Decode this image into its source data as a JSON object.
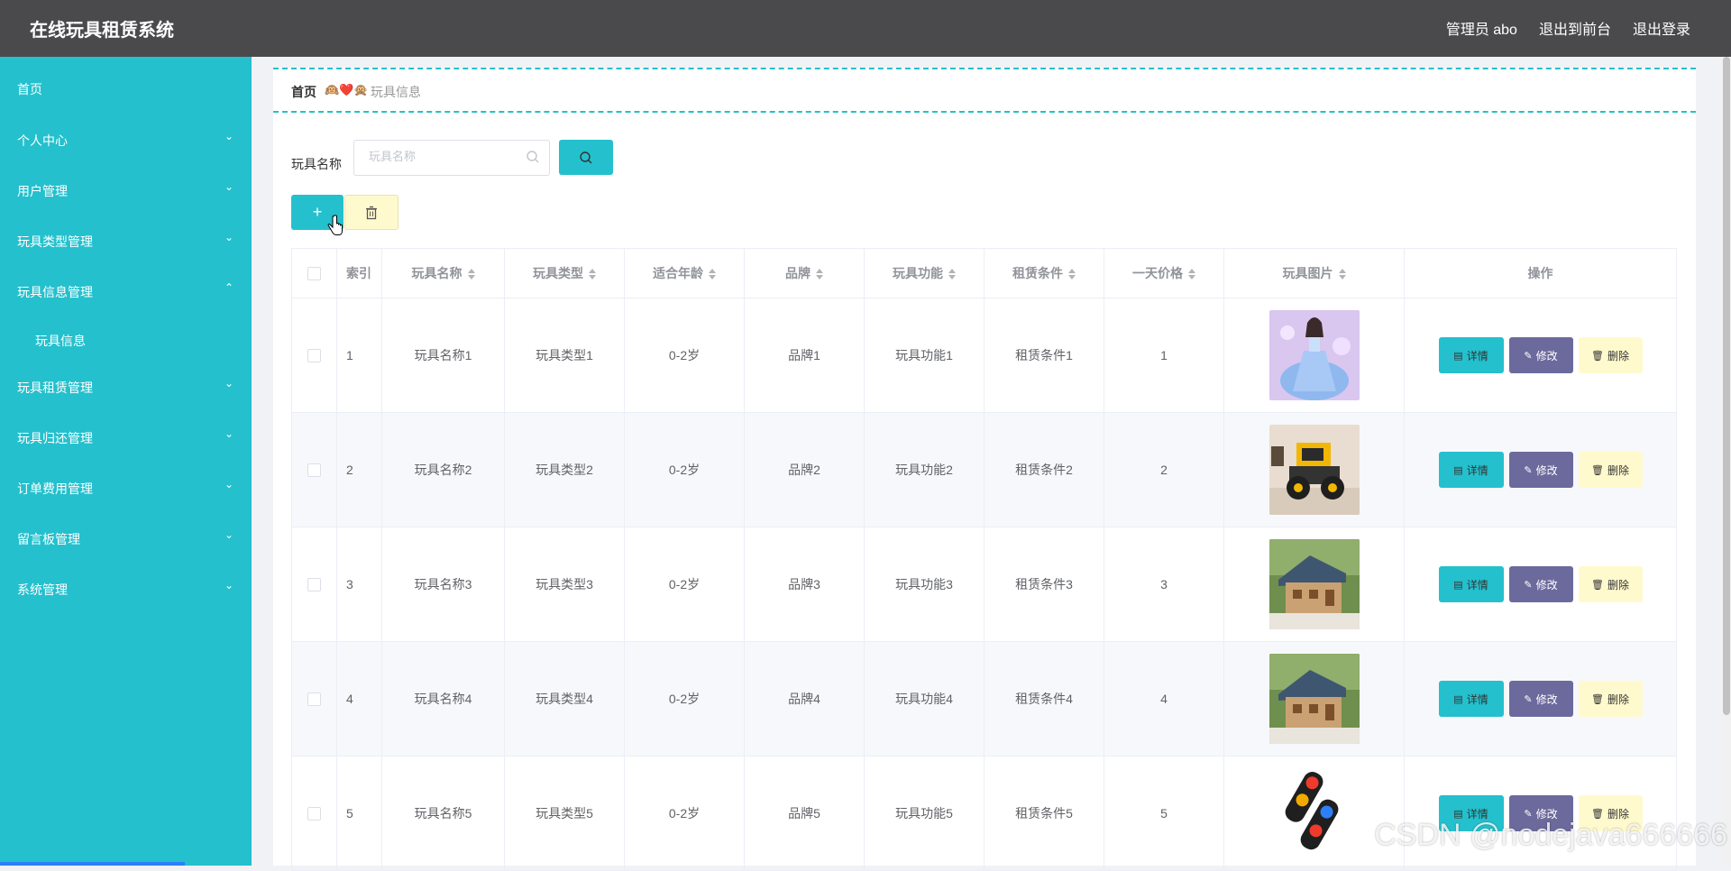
{
  "header": {
    "app_title": "在线玩具租赁系统",
    "user_label": "管理员 abo",
    "to_front_label": "退出到前台",
    "logout_label": "退出登录"
  },
  "sidebar": {
    "items": [
      {
        "label": "首页",
        "chevron": ""
      },
      {
        "label": "个人中心",
        "chevron": "⌄"
      },
      {
        "label": "用户管理",
        "chevron": "⌄"
      },
      {
        "label": "玩具类型管理",
        "chevron": "⌄"
      },
      {
        "label": "玩具信息管理",
        "chevron": "⌃"
      },
      {
        "label": "玩具信息",
        "chevron": "",
        "sub": true
      },
      {
        "label": "玩具租赁管理",
        "chevron": "⌄"
      },
      {
        "label": "玩具归还管理",
        "chevron": "⌄"
      },
      {
        "label": "订单费用管理",
        "chevron": "⌄"
      },
      {
        "label": "留言板管理",
        "chevron": "⌄"
      },
      {
        "label": "系统管理",
        "chevron": "⌄"
      }
    ]
  },
  "breadcrumb": {
    "home": "首页",
    "separator": "🙉❤️🙊",
    "current": "玩具信息"
  },
  "search": {
    "label": "玩具名称",
    "placeholder": "玩具名称",
    "value": ""
  },
  "toolbar": {
    "add_label": "+"
  },
  "table": {
    "headers": [
      "索引",
      "玩具名称",
      "玩具类型",
      "适合年龄",
      "品牌",
      "玩具功能",
      "租赁条件",
      "一天价格",
      "玩具图片",
      "操作"
    ],
    "rows": [
      {
        "index": "1",
        "name": "玩具名称1",
        "type": "玩具类型1",
        "age": "0-2岁",
        "brand": "品牌1",
        "function": "玩具功能1",
        "condition": "租赁条件1",
        "price": "1",
        "image": "doll"
      },
      {
        "index": "2",
        "name": "玩具名称2",
        "type": "玩具类型2",
        "age": "0-2岁",
        "brand": "品牌2",
        "function": "玩具功能2",
        "condition": "租赁条件2",
        "price": "2",
        "image": "truck"
      },
      {
        "index": "3",
        "name": "玩具名称3",
        "type": "玩具类型3",
        "age": "0-2岁",
        "brand": "品牌3",
        "function": "玩具功能3",
        "condition": "租赁条件3",
        "price": "3",
        "image": "house"
      },
      {
        "index": "4",
        "name": "玩具名称4",
        "type": "玩具类型4",
        "age": "0-2岁",
        "brand": "品牌4",
        "function": "玩具功能4",
        "condition": "租赁条件4",
        "price": "4",
        "image": "house"
      },
      {
        "index": "5",
        "name": "玩具名称5",
        "type": "玩具类型5",
        "age": "0-2岁",
        "brand": "品牌5",
        "function": "玩具功能5",
        "condition": "租赁条件5",
        "price": "5",
        "image": "blocks"
      }
    ],
    "actions": {
      "detail": "详情",
      "edit": "修改",
      "delete": "删除"
    }
  },
  "watermark": "CSDN @nodejava666666",
  "colors": {
    "primary": "#24c0cd",
    "header_bg": "#4a4a4d",
    "edit_bg": "#6c6a9c",
    "delete_bg": "#fffacd"
  }
}
